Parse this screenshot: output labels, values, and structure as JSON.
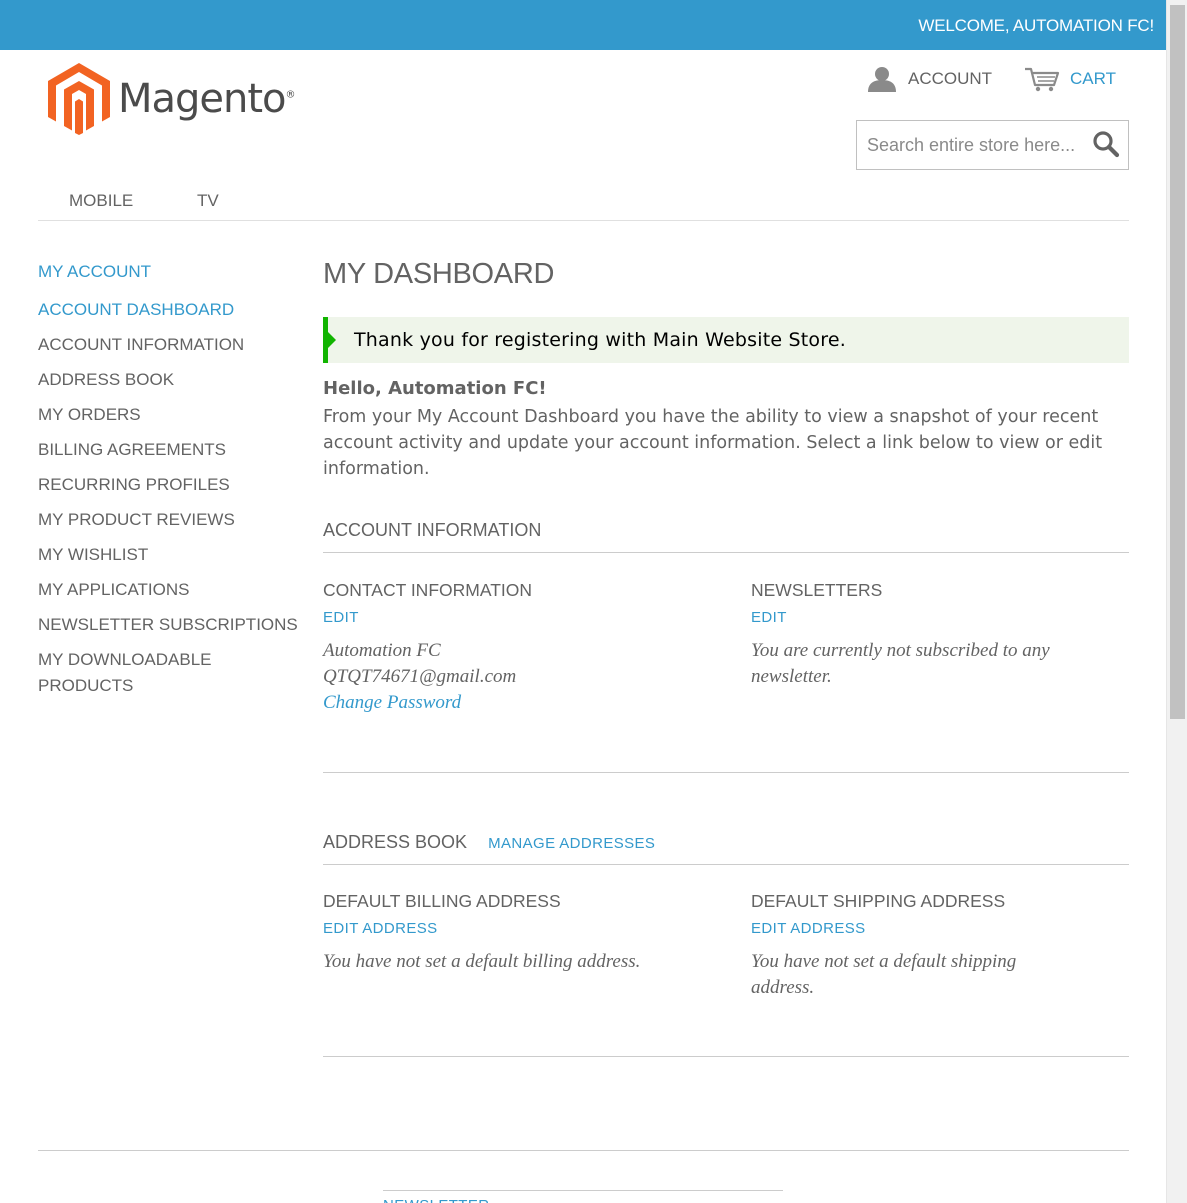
{
  "header": {
    "welcome": "WELCOME, AUTOMATION FC!",
    "logo_text": "Magento",
    "logo_mark": "®",
    "account_label": "ACCOUNT",
    "cart_label": "CART",
    "search_placeholder": "Search entire store here..."
  },
  "nav": {
    "items": [
      {
        "label": "MOBILE"
      },
      {
        "label": "TV"
      }
    ]
  },
  "sidebar": {
    "title": "MY ACCOUNT",
    "items": [
      {
        "label": "ACCOUNT DASHBOARD"
      },
      {
        "label": "ACCOUNT INFORMATION"
      },
      {
        "label": "ADDRESS BOOK"
      },
      {
        "label": "MY ORDERS"
      },
      {
        "label": "BILLING AGREEMENTS"
      },
      {
        "label": "RECURRING PROFILES"
      },
      {
        "label": "MY PRODUCT REVIEWS"
      },
      {
        "label": "MY WISHLIST"
      },
      {
        "label": "MY APPLICATIONS"
      },
      {
        "label": "NEWSLETTER SUBSCRIPTIONS"
      },
      {
        "label": "MY DOWNLOADABLE PRODUCTS"
      }
    ]
  },
  "main": {
    "title": "MY DASHBOARD",
    "success_message": "Thank you for registering with Main Website Store.",
    "hello": "Hello, Automation FC!",
    "intro": "From your My Account Dashboard you have the ability to view a snapshot of your recent account activity and update your account information. Select a link below to view or edit information.",
    "account_info": {
      "heading": "ACCOUNT INFORMATION",
      "contact": {
        "title": "CONTACT INFORMATION",
        "edit": "EDIT",
        "name": "Automation FC",
        "email": "QTQT74671@gmail.com",
        "change_password": "Change Password"
      },
      "newsletters": {
        "title": "NEWSLETTERS",
        "edit": "EDIT",
        "text": "You are currently not subscribed to any newsletter."
      }
    },
    "address_book": {
      "heading": "ADDRESS BOOK",
      "manage": "MANAGE ADDRESSES",
      "billing": {
        "title": "DEFAULT BILLING ADDRESS",
        "edit": "EDIT ADDRESS",
        "text": "You have not set a default billing address."
      },
      "shipping": {
        "title": "DEFAULT SHIPPING ADDRESS",
        "edit": "EDIT ADDRESS",
        "text": "You have not set a default shipping address."
      }
    }
  },
  "footer": {
    "newsletter": "NEWSLETTER"
  },
  "colors": {
    "accent": "#3399cc",
    "success": "#11b400",
    "success_bg": "#eff5ea",
    "logo_orange": "#f26322"
  }
}
